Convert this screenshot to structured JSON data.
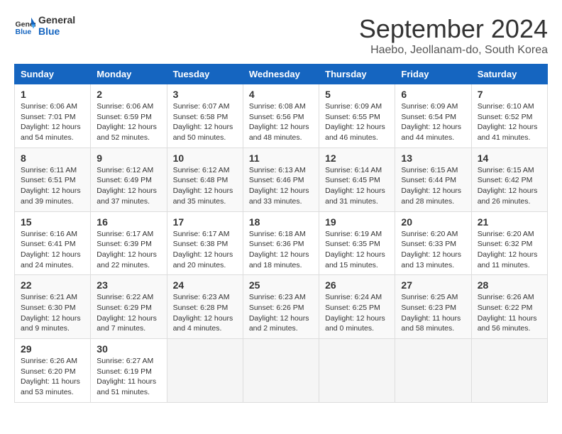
{
  "logo": {
    "line1": "General",
    "line2": "Blue"
  },
  "title": "September 2024",
  "location": "Haebo, Jeollanam-do, South Korea",
  "headers": [
    "Sunday",
    "Monday",
    "Tuesday",
    "Wednesday",
    "Thursday",
    "Friday",
    "Saturday"
  ],
  "weeks": [
    [
      {
        "day": "1",
        "info": "Sunrise: 6:06 AM\nSunset: 7:01 PM\nDaylight: 12 hours\nand 54 minutes."
      },
      {
        "day": "2",
        "info": "Sunrise: 6:06 AM\nSunset: 6:59 PM\nDaylight: 12 hours\nand 52 minutes."
      },
      {
        "day": "3",
        "info": "Sunrise: 6:07 AM\nSunset: 6:58 PM\nDaylight: 12 hours\nand 50 minutes."
      },
      {
        "day": "4",
        "info": "Sunrise: 6:08 AM\nSunset: 6:56 PM\nDaylight: 12 hours\nand 48 minutes."
      },
      {
        "day": "5",
        "info": "Sunrise: 6:09 AM\nSunset: 6:55 PM\nDaylight: 12 hours\nand 46 minutes."
      },
      {
        "day": "6",
        "info": "Sunrise: 6:09 AM\nSunset: 6:54 PM\nDaylight: 12 hours\nand 44 minutes."
      },
      {
        "day": "7",
        "info": "Sunrise: 6:10 AM\nSunset: 6:52 PM\nDaylight: 12 hours\nand 41 minutes."
      }
    ],
    [
      {
        "day": "8",
        "info": "Sunrise: 6:11 AM\nSunset: 6:51 PM\nDaylight: 12 hours\nand 39 minutes."
      },
      {
        "day": "9",
        "info": "Sunrise: 6:12 AM\nSunset: 6:49 PM\nDaylight: 12 hours\nand 37 minutes."
      },
      {
        "day": "10",
        "info": "Sunrise: 6:12 AM\nSunset: 6:48 PM\nDaylight: 12 hours\nand 35 minutes."
      },
      {
        "day": "11",
        "info": "Sunrise: 6:13 AM\nSunset: 6:46 PM\nDaylight: 12 hours\nand 33 minutes."
      },
      {
        "day": "12",
        "info": "Sunrise: 6:14 AM\nSunset: 6:45 PM\nDaylight: 12 hours\nand 31 minutes."
      },
      {
        "day": "13",
        "info": "Sunrise: 6:15 AM\nSunset: 6:44 PM\nDaylight: 12 hours\nand 28 minutes."
      },
      {
        "day": "14",
        "info": "Sunrise: 6:15 AM\nSunset: 6:42 PM\nDaylight: 12 hours\nand 26 minutes."
      }
    ],
    [
      {
        "day": "15",
        "info": "Sunrise: 6:16 AM\nSunset: 6:41 PM\nDaylight: 12 hours\nand 24 minutes."
      },
      {
        "day": "16",
        "info": "Sunrise: 6:17 AM\nSunset: 6:39 PM\nDaylight: 12 hours\nand 22 minutes."
      },
      {
        "day": "17",
        "info": "Sunrise: 6:17 AM\nSunset: 6:38 PM\nDaylight: 12 hours\nand 20 minutes."
      },
      {
        "day": "18",
        "info": "Sunrise: 6:18 AM\nSunset: 6:36 PM\nDaylight: 12 hours\nand 18 minutes."
      },
      {
        "day": "19",
        "info": "Sunrise: 6:19 AM\nSunset: 6:35 PM\nDaylight: 12 hours\nand 15 minutes."
      },
      {
        "day": "20",
        "info": "Sunrise: 6:20 AM\nSunset: 6:33 PM\nDaylight: 12 hours\nand 13 minutes."
      },
      {
        "day": "21",
        "info": "Sunrise: 6:20 AM\nSunset: 6:32 PM\nDaylight: 12 hours\nand 11 minutes."
      }
    ],
    [
      {
        "day": "22",
        "info": "Sunrise: 6:21 AM\nSunset: 6:30 PM\nDaylight: 12 hours\nand 9 minutes."
      },
      {
        "day": "23",
        "info": "Sunrise: 6:22 AM\nSunset: 6:29 PM\nDaylight: 12 hours\nand 7 minutes."
      },
      {
        "day": "24",
        "info": "Sunrise: 6:23 AM\nSunset: 6:28 PM\nDaylight: 12 hours\nand 4 minutes."
      },
      {
        "day": "25",
        "info": "Sunrise: 6:23 AM\nSunset: 6:26 PM\nDaylight: 12 hours\nand 2 minutes."
      },
      {
        "day": "26",
        "info": "Sunrise: 6:24 AM\nSunset: 6:25 PM\nDaylight: 12 hours\nand 0 minutes."
      },
      {
        "day": "27",
        "info": "Sunrise: 6:25 AM\nSunset: 6:23 PM\nDaylight: 11 hours\nand 58 minutes."
      },
      {
        "day": "28",
        "info": "Sunrise: 6:26 AM\nSunset: 6:22 PM\nDaylight: 11 hours\nand 56 minutes."
      }
    ],
    [
      {
        "day": "29",
        "info": "Sunrise: 6:26 AM\nSunset: 6:20 PM\nDaylight: 11 hours\nand 53 minutes."
      },
      {
        "day": "30",
        "info": "Sunrise: 6:27 AM\nSunset: 6:19 PM\nDaylight: 11 hours\nand 51 minutes."
      },
      {
        "day": "",
        "info": ""
      },
      {
        "day": "",
        "info": ""
      },
      {
        "day": "",
        "info": ""
      },
      {
        "day": "",
        "info": ""
      },
      {
        "day": "",
        "info": ""
      }
    ]
  ]
}
